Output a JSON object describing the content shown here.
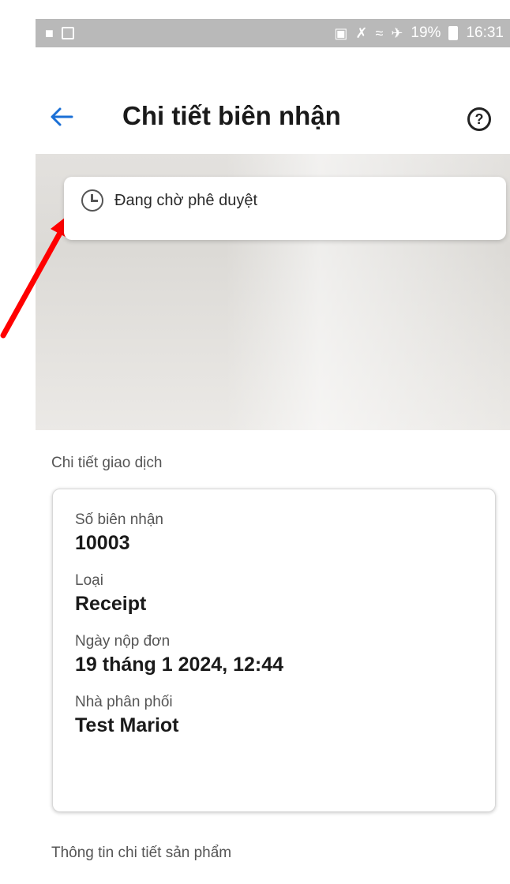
{
  "status_bar": {
    "left_icons": [
      "teams-icon",
      "checkbox-icon"
    ],
    "right_icons": [
      "lock-icon",
      "mute-icon",
      "wifi-icon",
      "airplane-icon"
    ],
    "battery_percent": "19%",
    "time": "16:31"
  },
  "header": {
    "title": "Chi tiết biên nhận",
    "back_icon": "arrow-left-icon",
    "help_icon": "help-circle-icon"
  },
  "status_card": {
    "icon": "clock-icon",
    "text": "Đang chờ phê duyệt"
  },
  "transaction": {
    "section_label": "Chi tiết giao dịch",
    "fields": [
      {
        "label": "Số biên nhận",
        "value": "10003"
      },
      {
        "label": "Loại",
        "value": "Receipt"
      },
      {
        "label": "Ngày nộp đơn",
        "value": "19 tháng 1 2024, 12:44"
      },
      {
        "label": "Nhà phân phối",
        "value": "Test Mariot"
      }
    ]
  },
  "product": {
    "section_label": "Thông tin chi tiết sản phẩm"
  },
  "annotation_color": "#ff0000"
}
